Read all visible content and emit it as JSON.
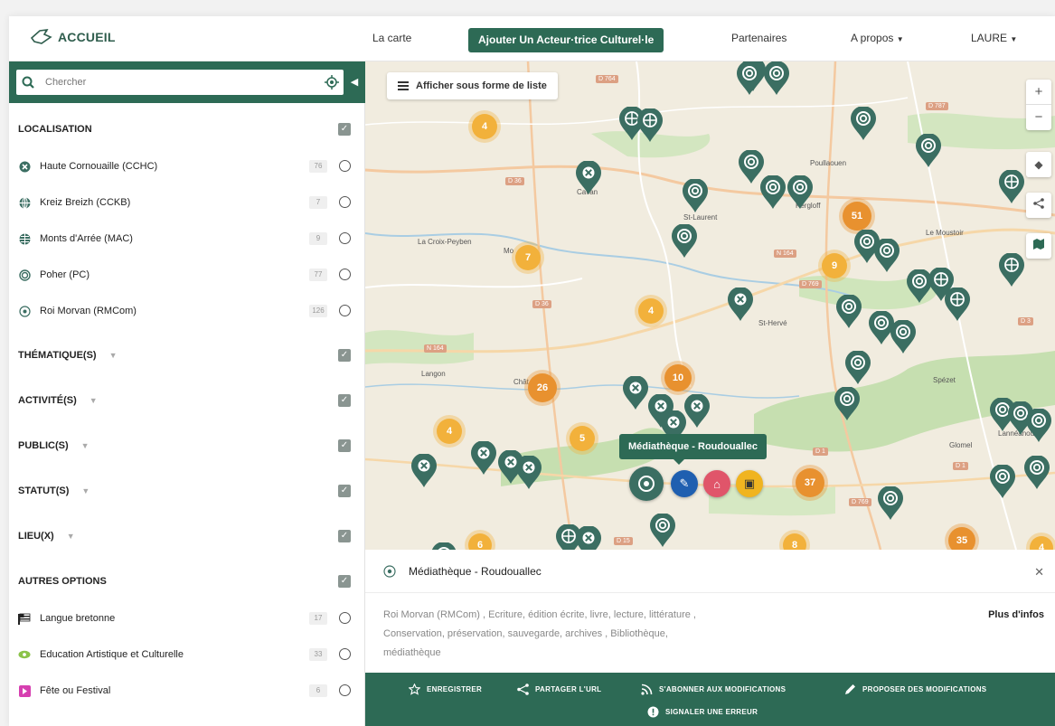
{
  "header": {
    "logo": "ACCUEIL",
    "nav": [
      "La carte",
      "Partenaires",
      "A propos",
      "LAURE"
    ],
    "add_button": "Ajouter Un Acteur·trice Culturel·le"
  },
  "sidebar": {
    "search_placeholder": "Chercher",
    "localisation": {
      "title": "LOCALISATION",
      "items": [
        {
          "label": "Haute Cornouaille (CCHC)",
          "count": "76"
        },
        {
          "label": "Kreiz Breizh (CCKB)",
          "count": "7"
        },
        {
          "label": "Monts d'Arrée (MAC)",
          "count": "9"
        },
        {
          "label": "Poher (PC)",
          "count": "77"
        },
        {
          "label": "Roi Morvan (RMCom)",
          "count": "126"
        }
      ]
    },
    "filters": [
      "THÉMATIQUE(S)",
      "ACTIVITÉ(S)",
      "PUBLIC(S)",
      "STATUT(S)",
      "LIEU(X)"
    ],
    "options": {
      "title": "AUTRES OPTIONS",
      "items": [
        {
          "label": "Langue bretonne",
          "count": "17"
        },
        {
          "label": "Education Artistique et Culturelle",
          "count": "33"
        },
        {
          "label": "Fête ou Festival",
          "count": "6"
        }
      ]
    }
  },
  "map": {
    "list_button": "Afficher sous forme de liste",
    "tooltip": "Médiathèque - Roudouallec",
    "places": [
      "Cavan",
      "La Croix-Peyben",
      "Mo",
      "Chât",
      "Langon",
      "Poullaouen",
      "Kergloff",
      "St-Laurent",
      "St-Hervé",
      "Le Moustoir",
      "Lannéanou",
      "Glomel",
      "Spézet"
    ],
    "roads": [
      "D 764",
      "D 787",
      "D 36",
      "D 769",
      "N 164",
      "D 15",
      "D 1",
      "D 3"
    ],
    "clusters": [
      "4",
      "7",
      "4",
      "51",
      "9",
      "26",
      "10",
      "4",
      "5",
      "37",
      "6",
      "8",
      "35",
      "4"
    ],
    "controls": [
      "+",
      "−"
    ]
  },
  "panel": {
    "title": "Médiathèque - Roudouallec",
    "tags_line1": "Roi Morvan (RMCom) ,  Ecriture, édition écrite, livre, lecture, littérature ,",
    "tags_line2": "Conservation, préservation, sauvegarde, archives ,  Bibliothèque,",
    "tags_line3": "médiathèque",
    "more": "Plus d'infos",
    "actions": [
      "ENREGISTRER",
      "PARTAGER L'URL",
      "S'ABONNER AUX MODIFICATIONS",
      "PROPOSER DES MODIFICATIONS",
      "SIGNALER UNE ERREUR"
    ]
  },
  "colors": {
    "brand_green": "#2d6a55",
    "orange": "#e8912f",
    "yellow": "#f2b13b",
    "pin": "#3b6e62"
  }
}
